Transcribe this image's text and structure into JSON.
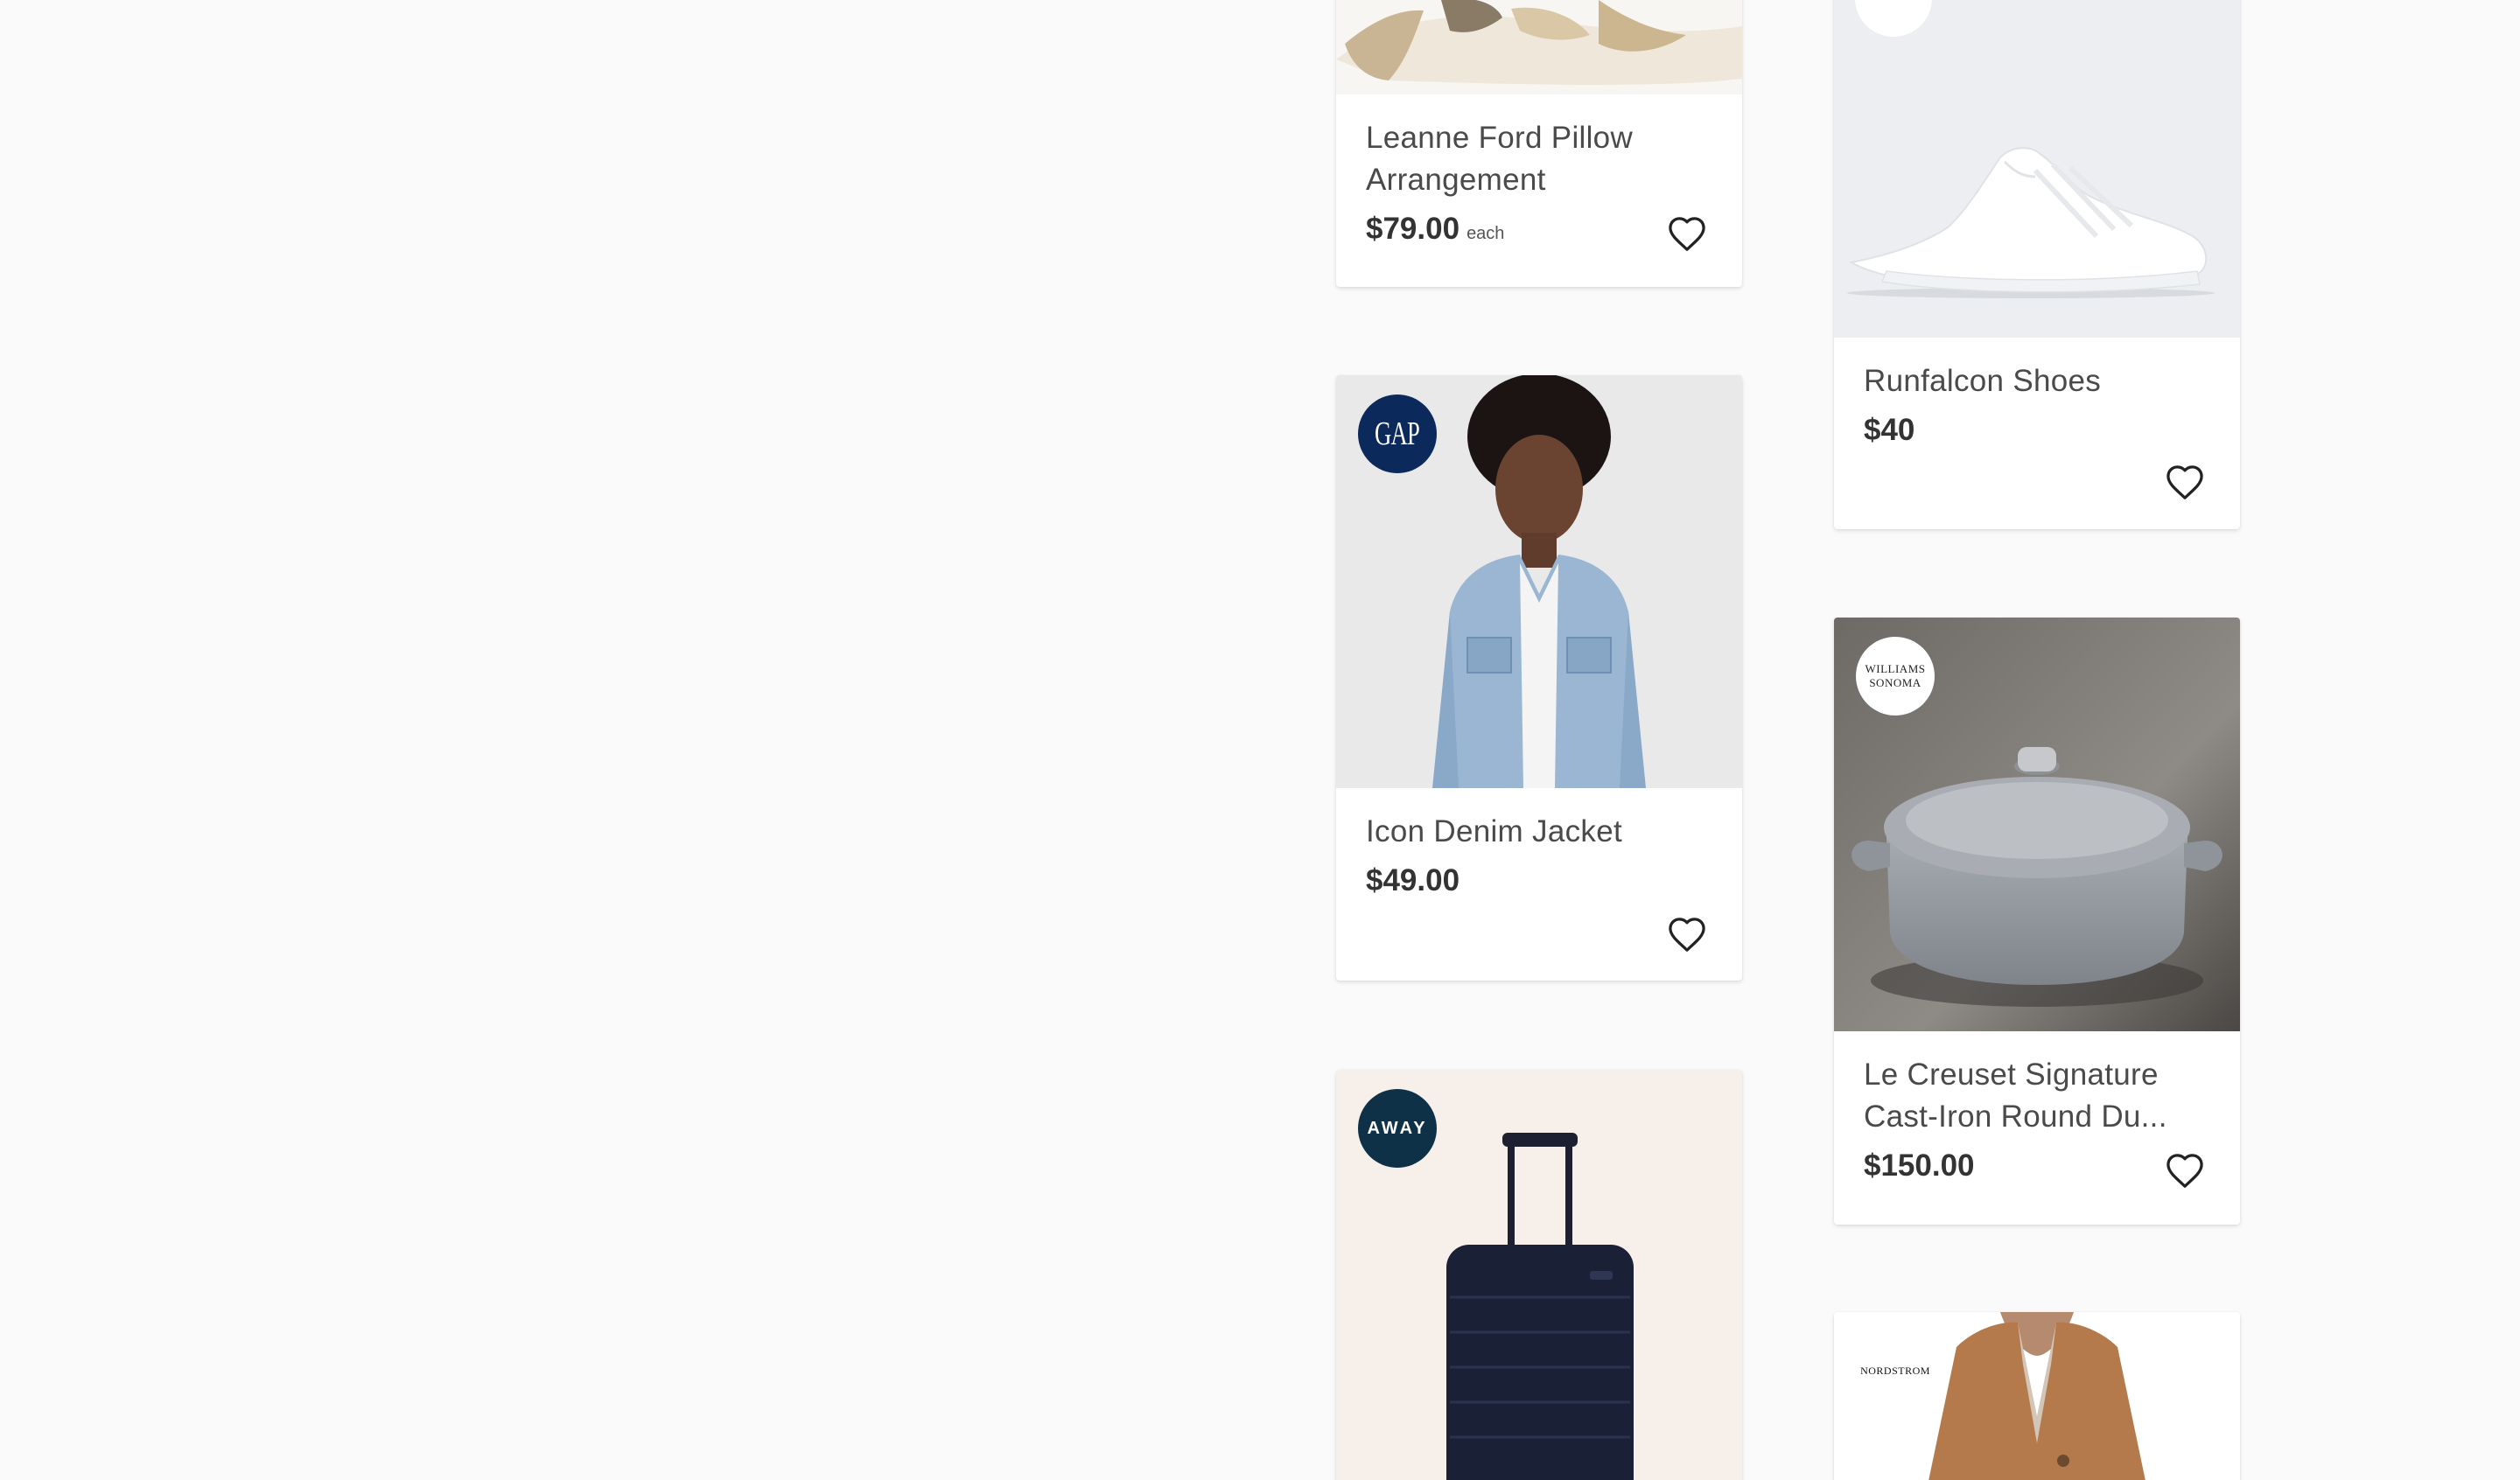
{
  "products": [
    {
      "title": "Leanne Ford Pillow Arrangement",
      "price": "$79.00",
      "price_unit": "each",
      "favorite_icon": "heart-outline-icon"
    },
    {
      "title": "Runfalcon Shoes",
      "price": "$40",
      "favorite_icon": "heart-outline-icon"
    },
    {
      "title": "Icon Denim Jacket",
      "price": "$49.00",
      "brand": "GAP",
      "brand_color": "#0b2a5b",
      "favorite_icon": "heart-outline-icon"
    },
    {
      "title": "Le Creuset Signature Cast-Iron Round Du...",
      "price": "$150.00",
      "brand_line1": "WILLIAMS",
      "brand_line2": "SONOMA",
      "favorite_icon": "heart-outline-icon"
    },
    {
      "brand": "AWAY",
      "brand_color": "#0e3148"
    },
    {
      "brand": "NORDSTROM"
    }
  ],
  "colors": {
    "background": "#fafafa",
    "card": "#ffffff",
    "title_text": "#4a4a4a",
    "price_text": "#333333"
  }
}
